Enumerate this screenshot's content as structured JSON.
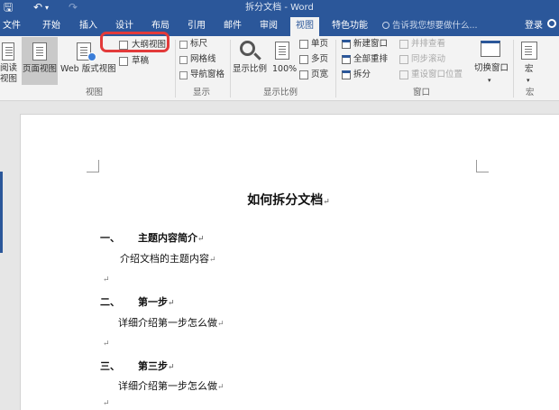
{
  "window": {
    "title": "拆分文档 - Word"
  },
  "quick_access": {
    "save_glyph": "🖫",
    "undo_glyph": "↶",
    "undo_arrow_glyph": "▾",
    "redo_glyph": "↷"
  },
  "tabs": [
    {
      "label": "文件",
      "active": false
    },
    {
      "label": "开始",
      "active": false
    },
    {
      "label": "插入",
      "active": false
    },
    {
      "label": "设计",
      "active": false
    },
    {
      "label": "布局",
      "active": false
    },
    {
      "label": "引用",
      "active": false
    },
    {
      "label": "邮件",
      "active": false
    },
    {
      "label": "审阅",
      "active": false
    },
    {
      "label": "视图",
      "active": true
    },
    {
      "label": "特色功能",
      "active": false
    }
  ],
  "tell_me": {
    "placeholder": "告诉我您想要做什么..."
  },
  "account": {
    "login_label": "登录"
  },
  "ribbon": {
    "views": {
      "read_mode_label_1": "阅读",
      "read_mode_label_2": "视图",
      "print_layout_label": "页面视图",
      "web_layout_label": "Web 版式视图",
      "outline_label": "大纲视图",
      "draft_label": "草稿",
      "group_label": "视图"
    },
    "show": {
      "ruler_label": "标尺",
      "gridlines_label": "网格线",
      "nav_pane_label": "导航窗格",
      "group_label": "显示"
    },
    "zoom": {
      "zoom_label": "显示比例",
      "percent_label": "100%",
      "one_page_label": "单页",
      "multi_page_label": "多页",
      "page_width_label": "页宽",
      "group_label": "显示比例"
    },
    "window": {
      "new_window_label": "新建窗口",
      "arrange_all_label": "全部重排",
      "split_label": "拆分",
      "side_by_side_label": "并排查看",
      "sync_scroll_label": "同步滚动",
      "reset_position_label": "重设窗口位置",
      "switch_windows_label": "切换窗口",
      "group_label": "窗口"
    },
    "macros": {
      "macros_label": "宏",
      "group_label": "宏"
    }
  },
  "document": {
    "title": "如何拆分文档",
    "sections": [
      {
        "number": "一、",
        "heading": "主题内容简介",
        "body": "介绍文档的主题内容"
      },
      {
        "number": "二、",
        "heading": "第一步",
        "body": "详细介绍第一步怎么做"
      },
      {
        "number": "三、",
        "heading": "第三步",
        "body": "详细介绍第一步怎么做"
      }
    ],
    "paragraph_mark": "↵"
  },
  "colors": {
    "brand": "#2b579a",
    "ribbon_bg": "#f3f3f3",
    "highlight": "#e23a3a"
  }
}
